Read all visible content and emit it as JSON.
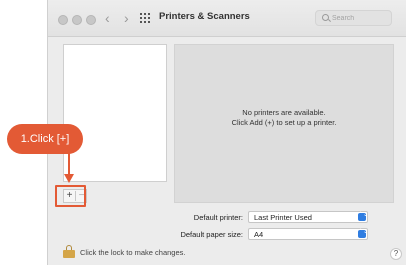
{
  "window": {
    "title": "Printers & Scanners",
    "back_glyph": "‹",
    "forward_glyph": "›"
  },
  "search": {
    "placeholder": "Search"
  },
  "printer_list": {
    "add_label": "+",
    "remove_label": "−"
  },
  "detail": {
    "empty_line1": "No printers are available.",
    "empty_line2": "Click Add (+) to set up a printer."
  },
  "settings": {
    "default_printer_label": "Default printer:",
    "default_printer_value": "Last Printer Used",
    "paper_size_label": "Default paper size:",
    "paper_size_value": "A4",
    "stepper_glyph": "⌃⌄"
  },
  "footer": {
    "lock_text": "Click the lock to make changes.",
    "help_label": "?"
  },
  "annotation": {
    "callout_text": "1.Click [+]",
    "color": "#e35a35"
  },
  "icons": {
    "traffic_lights": [
      "close-button",
      "minimize-button",
      "zoom-button"
    ],
    "grid": "show-all-grid-icon",
    "search": "search-icon",
    "lock": "lock-icon"
  },
  "colors": {
    "accent": "#2f7de1",
    "window_bg": "#ececec",
    "pane_bg": "#dddddd"
  }
}
